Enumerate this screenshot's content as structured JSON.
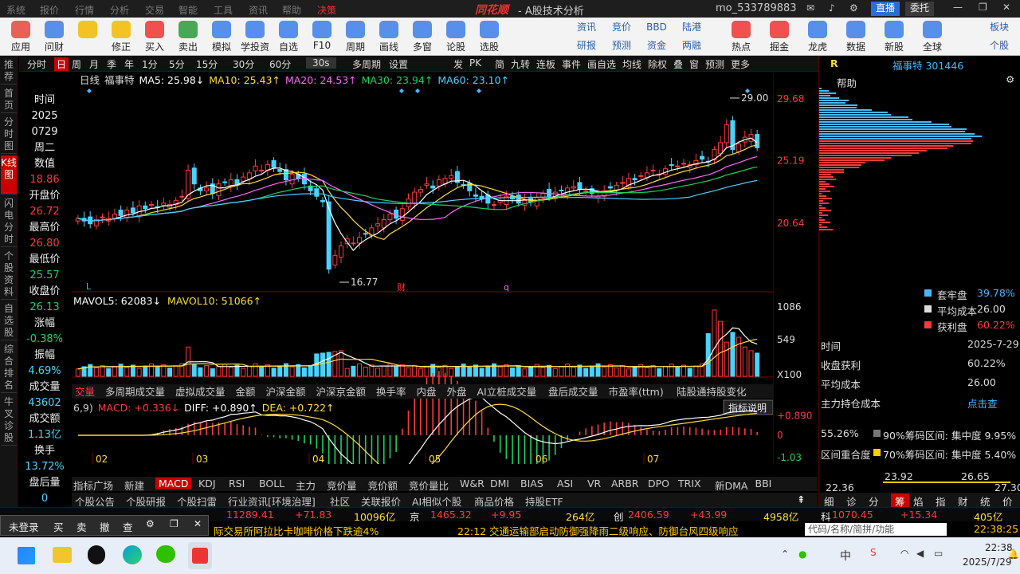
{
  "menu": {
    "items": [
      "系统",
      "报价",
      "行情",
      "分析",
      "交易",
      "智能",
      "工具",
      "资讯",
      "帮助",
      "决策"
    ],
    "logo": "同花顺",
    "title": "- A股技术分析",
    "account": "mo_533789883",
    "live": "直播",
    "delegate": "委托"
  },
  "toolbar": {
    "big": [
      {
        "label": "应用",
        "color": "#e8453c"
      },
      {
        "label": "问财",
        "color": "#3b7de9"
      },
      {
        "label": "",
        "color": "#f5b800"
      },
      {
        "label": "修正",
        "color": "#f5b800"
      },
      {
        "label": "买入",
        "color": "#e33"
      },
      {
        "label": "卖出",
        "color": "#2a9a3a"
      },
      {
        "label": "模拟",
        "color": "#3b7de9"
      },
      {
        "label": "学投资",
        "color": "#3b7de9"
      },
      {
        "label": "自选",
        "color": "#3b7de9"
      },
      {
        "label": "F10",
        "color": "#3b7de9"
      },
      {
        "label": "周期",
        "color": "#3b7de9"
      },
      {
        "label": "画线",
        "color": "#3b7de9"
      },
      {
        "label": "多窗",
        "color": "#3b7de9"
      },
      {
        "label": "论股",
        "color": "#3b7de9"
      },
      {
        "label": "选股",
        "color": "#3b7de9"
      }
    ],
    "small": [
      [
        "资讯",
        "竞价",
        "BBD",
        "陆港"
      ],
      [
        "研报",
        "预测",
        "资金",
        "两融"
      ]
    ],
    "big2": [
      {
        "label": "热点",
        "color": "#e33"
      },
      {
        "label": "掘金",
        "color": "#e33"
      },
      {
        "label": "龙虎",
        "color": "#3b7de9"
      },
      {
        "label": "数据",
        "color": "#3b7de9"
      },
      {
        "label": "新股",
        "color": "#3b7de9"
      },
      {
        "label": "全球",
        "color": "#3b7de9"
      }
    ],
    "corner": [
      "板块",
      "个股"
    ]
  },
  "period": {
    "tabs": [
      "分时",
      "日",
      "周",
      "月",
      "季",
      "年",
      "1分",
      "5分",
      "15分",
      "30分",
      "60分",
      "30s",
      "多周期",
      "设置"
    ],
    "right": [
      "发",
      "PK",
      "简",
      "九转",
      "连板",
      "事件",
      "画自选",
      "均线",
      "除权",
      "叠",
      "窗",
      "预测",
      "更多"
    ]
  },
  "left_tabs": [
    "推荐",
    "首页",
    "分时图",
    "K线图",
    "闪电分时",
    "个股资料",
    "自选股",
    "综合排名",
    "牛叉诊股"
  ],
  "info": [
    {
      "k": "时间",
      "v": "2025",
      "c": "wht"
    },
    {
      "k": "",
      "v": "0729",
      "c": "wht"
    },
    {
      "k": "周二",
      "v": "",
      "c": "wht"
    },
    {
      "k": "数值",
      "v": "18.86",
      "c": "red"
    },
    {
      "k": "开盘价",
      "v": "26.72",
      "c": "red"
    },
    {
      "k": "最高价",
      "v": "26.80",
      "c": "red"
    },
    {
      "k": "最低价",
      "v": "25.57",
      "c": "grn"
    },
    {
      "k": "收盘价",
      "v": "26.13",
      "c": "grn"
    },
    {
      "k": "涨幅",
      "v": "-0.38%",
      "c": "grn"
    },
    {
      "k": "振幅",
      "v": "4.69%",
      "c": "cyn"
    },
    {
      "k": "成交量",
      "v": "43602",
      "c": "cyn"
    },
    {
      "k": "成交额",
      "v": "1.13亿",
      "c": "cyn"
    },
    {
      "k": "换手",
      "v": "13.72%",
      "c": "cyn"
    },
    {
      "k": "盘后量",
      "v": "0",
      "c": "cyn"
    }
  ],
  "kline": {
    "header": {
      "type": "日线",
      "name": "福事特",
      "ma5": "MA5: 25.98↓",
      "ma10": "MA10: 25.43↑",
      "ma20": "MA20: 24.53↑",
      "ma30": "MA30: 23.94↑",
      "ma60": "MA60: 23.10↑"
    },
    "y_ticks": [
      "29.68",
      "25.19",
      "20.64"
    ],
    "high_label": "29.00",
    "low_label": "16.77",
    "marks": [
      "L",
      "财",
      "q"
    ]
  },
  "volume": {
    "header": {
      "mavol5": "MAVOL5: 62083↓",
      "mavol10": "MAVOL10: 51066↑"
    },
    "y_ticks": [
      "1086",
      "549",
      "X100"
    ]
  },
  "indicator_tabs": [
    "交量",
    "多周期成交量",
    "虚拟成交量",
    "金额",
    "沪深金额",
    "沪深京金额",
    "换手率",
    "内盘",
    "外盘",
    "AI立桩成交量",
    "盘后成交量",
    "市盈率(ttm)",
    "陆股通持股变化"
  ],
  "macd": {
    "header": {
      "params": "6,9)",
      "macd": "MACD: +0.336↓",
      "diff": "DIFF: +0.890↑",
      "dea": "DEA: +0.722↑"
    },
    "y_ticks": [
      "+0.890",
      "0",
      "-1.03"
    ],
    "help": "指标说明",
    "months": [
      "02",
      "03",
      "04",
      "05",
      "06",
      "07"
    ]
  },
  "chart_data": {
    "type": "candlestick",
    "title": "福事特 日线",
    "ylim": [
      16.0,
      30.5
    ],
    "y_ticks": [
      29.68,
      25.19,
      20.64
    ],
    "x_months": [
      "02",
      "03",
      "04",
      "05",
      "06",
      "07"
    ],
    "series": [
      {
        "name": "MA5",
        "value": 25.98
      },
      {
        "name": "MA10",
        "value": 25.43
      },
      {
        "name": "MA20",
        "value": 24.53
      },
      {
        "name": "MA30",
        "value": 23.94
      },
      {
        "name": "MA60",
        "value": 23.1
      }
    ],
    "close": [
      21.0,
      20.8,
      20.6,
      20.9,
      21.1,
      21.0,
      21.3,
      21.2,
      21.6,
      21.4,
      21.9,
      21.7,
      22.0,
      21.8,
      22.1,
      22.0,
      22.3,
      22.6,
      24.5,
      23.5,
      23.0,
      23.2,
      22.8,
      23.5,
      23.6,
      23.8,
      23.4,
      24.0,
      24.3,
      24.8,
      24.5,
      24.9,
      24.7,
      24.4,
      23.8,
      24.2,
      23.9,
      23.5,
      23.0,
      22.6,
      22.2,
      17.3,
      18.3,
      19.0,
      19.5,
      19.2,
      19.6,
      19.9,
      20.3,
      20.6,
      20.9,
      21.3,
      21.0,
      21.7,
      22.4,
      22.9,
      23.1,
      23.5,
      23.2,
      23.8,
      23.9,
      24.1,
      23.6,
      23.4,
      23.0,
      22.6,
      22.4,
      22.1,
      22.0,
      22.3,
      22.6,
      22.4,
      22.1,
      22.3,
      22.2,
      22.5,
      22.8,
      22.6,
      22.9,
      23.0,
      23.2,
      23.3,
      23.1,
      23.0,
      22.8,
      22.6,
      23.0,
      23.2,
      23.4,
      23.6,
      23.9,
      23.8,
      24.1,
      24.3,
      24.5,
      24.2,
      24.6,
      24.9,
      24.8,
      25.0,
      24.9,
      25.2,
      25.3,
      25.1,
      26.0,
      26.5,
      27.8,
      26.0,
      26.4,
      26.9,
      27.1,
      26.13
    ],
    "volume_ylim": [
      0,
      1150
    ],
    "volume_y_ticks": [
      1086,
      549
    ],
    "volume_series": [
      {
        "name": "MAVOL5",
        "value": 62083
      },
      {
        "name": "MAVOL10",
        "value": 51066
      }
    ],
    "macd": {
      "macd": 0.336,
      "diff": 0.89,
      "dea": 0.722,
      "ylim": [
        -1.1,
        0.95
      ]
    }
  },
  "right_panel": {
    "code_tag": "R",
    "stock": "福事特 301446",
    "help": "帮助",
    "legend": [
      {
        "label": "套牢盘",
        "value": "39.78%",
        "color": "#46b8ff"
      },
      {
        "label": "平均成本",
        "value": "26.00",
        "color": "#dddddd"
      },
      {
        "label": "获利盘",
        "value": "60.22%",
        "color": "#ff3a3a"
      }
    ],
    "stats": [
      {
        "k": "时间",
        "v": "2025-7-29"
      },
      {
        "k": "收盘获利",
        "v": "60.22%"
      },
      {
        "k": "平均成本",
        "v": "26.00"
      },
      {
        "k": "主力持仓成本",
        "v": "点击查"
      }
    ],
    "concentration": [
      {
        "pct": "55.26%",
        "label": "90%筹码区间: 集中度 9.95%",
        "color": "#777777"
      },
      {
        "pct": "区间重合度",
        "label": "70%筹码区间: 集中度 5.40%",
        "color": "#ffcc00"
      }
    ],
    "range_top": [
      "23.92",
      "26.65"
    ],
    "range_bot": [
      "22.36",
      "27.30"
    ],
    "tabs": [
      "细",
      "诊",
      "分",
      "筹",
      "焰",
      "指",
      "财",
      "统",
      "价"
    ]
  },
  "bottom_indicators": [
    "指标广场",
    "新建",
    "MACD",
    "KDJ",
    "RSI",
    "BOLL",
    "主力",
    "竞价量",
    "竞价额",
    "竞价量比",
    "W&R",
    "DMI",
    "BIAS",
    "ASI",
    "VR",
    "ARBR",
    "DPO",
    "TRIX",
    "新DMA",
    "BBI"
  ],
  "bottom_info": [
    "个股公告",
    "个股研报",
    "个股扫雷",
    "行业资讯[环境治理]",
    "社区",
    "关联报价",
    "AI相似个股",
    "商品价格",
    "持股ETF"
  ],
  "quote_line": [
    {
      "t": "11289.41",
      "c": "red"
    },
    {
      "t": "+71.83",
      "c": "red"
    },
    {
      "t": "10096亿",
      "c": "yel"
    },
    {
      "t": "京",
      "c": "wht"
    },
    {
      "t": "1465.32",
      "c": "red"
    },
    {
      "t": "+9.95",
      "c": "red"
    },
    {
      "t": "264亿",
      "c": "yel"
    },
    {
      "t": "创",
      "c": "wht"
    },
    {
      "t": "2406.59",
      "c": "red"
    },
    {
      "t": "+43.99",
      "c": "red"
    },
    {
      "t": "4958亿",
      "c": "yel"
    },
    {
      "t": "科",
      "c": "wht"
    },
    {
      "t": "1070.45",
      "c": "red"
    },
    {
      "t": "+15.34",
      "c": "red"
    },
    {
      "t": "405亿",
      "c": "yel"
    }
  ],
  "news": {
    "left": "际交易所阿拉比卡咖啡价格下跌逾4%",
    "right": "22:12 交通运输部启动防御强降雨二级响应、防御台风四级响应",
    "search": "代码/名称/简拼/功能",
    "clock": "22:38:25"
  },
  "trade_popup": [
    "未登录",
    "买",
    "卖",
    "撤",
    "查"
  ],
  "taskbar": {
    "time": "22:38",
    "date": "2025/7/29",
    "ime": "中"
  }
}
